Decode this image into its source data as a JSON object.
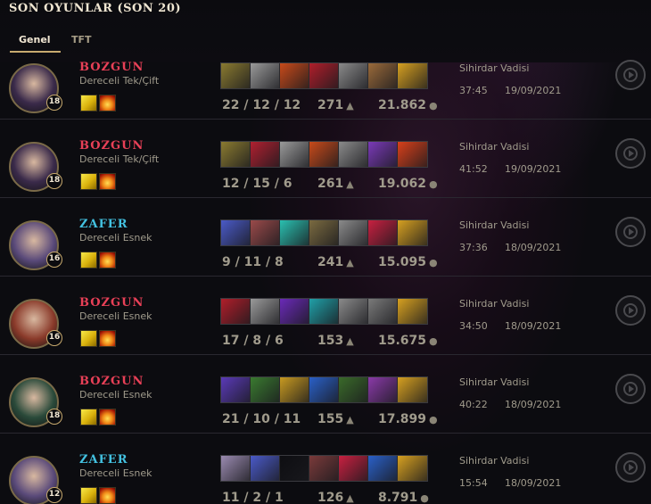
{
  "header": {
    "title": "SON OYUNLAR (SON 20)"
  },
  "tabs": [
    {
      "label": "Genel",
      "active": true
    },
    {
      "label": "TFT",
      "active": false
    }
  ],
  "colors": {
    "loss": "#e84057",
    "win": "#43c1e0",
    "gold_accent": "#c8aa6e"
  },
  "icons": {
    "cs": "minion-icon",
    "gold": "coins-icon",
    "replay": "replay-icon",
    "spells": [
      "ghost-icon",
      "ignite-icon"
    ]
  },
  "matches": [
    {
      "result": "BOZGUN",
      "queue": "Dereceli Tek/Çift",
      "level": "18",
      "kda": "22 / 12 / 12",
      "cs": "271",
      "gold": "21.862",
      "map": "Sihirdar Vadisi",
      "duration": "37:45",
      "date": "19/09/2021",
      "items": [
        "#8a7a30",
        "#9a9a9a",
        "#c84a1a",
        "#b01e2a",
        "#8a8a8a",
        "#9a6a3a",
        "#d6a020"
      ]
    },
    {
      "result": "BOZGUN",
      "queue": "Dereceli Tek/Çift",
      "level": "18",
      "kda": "12 / 15 / 6",
      "cs": "261",
      "gold": "19.062",
      "map": "Sihirdar Vadisi",
      "duration": "41:52",
      "date": "19/09/2021",
      "items": [
        "#8a7a30",
        "#b02030",
        "#9a9a9a",
        "#c84a1a",
        "#8a8a8a",
        "#7a3ab8",
        "#d8401a"
      ]
    },
    {
      "result": "ZAFER",
      "queue": "Dereceli Esnek",
      "level": "16",
      "kda": "9 / 11 / 8",
      "cs": "241",
      "gold": "15.095",
      "map": "Sihirdar Vadisi",
      "duration": "37:36",
      "date": "18/09/2021",
      "items": [
        "#4a5ac8",
        "#9a4a4a",
        "#2ac0b0",
        "#7a6a40",
        "#8a8a8a",
        "#c82040",
        "#d6a020"
      ]
    },
    {
      "result": "BOZGUN",
      "queue": "Dereceli Esnek",
      "level": "16",
      "kda": "17 / 8 / 6",
      "cs": "153",
      "gold": "15.675",
      "map": "Sihirdar Vadisi",
      "duration": "34:50",
      "date": "18/09/2021",
      "items": [
        "#b01e2a",
        "#9a9a9a",
        "#6a2ab8",
        "#20a0a8",
        "#8a8a8a",
        "#7a7a7a",
        "#d6a020"
      ]
    },
    {
      "result": "BOZGUN",
      "queue": "Dereceli Esnek",
      "level": "18",
      "kda": "21 / 10 / 11",
      "cs": "155",
      "gold": "17.899",
      "map": "Sihirdar Vadisi",
      "duration": "40:22",
      "date": "18/09/2021",
      "items": [
        "#5a3ab8",
        "#3a7a30",
        "#c89a20",
        "#2a60c8",
        "#3a6a2a",
        "#8a3aa8",
        "#d6a020"
      ]
    },
    {
      "result": "ZAFER",
      "queue": "Dereceli Esnek",
      "level": "12",
      "kda": "11 / 2 / 1",
      "cs": "126",
      "gold": "8.791",
      "map": "Sihirdar Vadisi",
      "duration": "15:54",
      "date": "18/09/2021",
      "items": [
        "#9a8ab0",
        "#4a5ac8",
        "#0e0e12",
        "#7a3a3a",
        "#c82040",
        "#2a60c8",
        "#d6a020"
      ]
    }
  ],
  "portraits": [
    "#3a2a4a",
    "#3a2a4a",
    "#5a4a7a",
    "#8a3a2a",
    "#2a4a3a",
    "#5a4a7a"
  ]
}
